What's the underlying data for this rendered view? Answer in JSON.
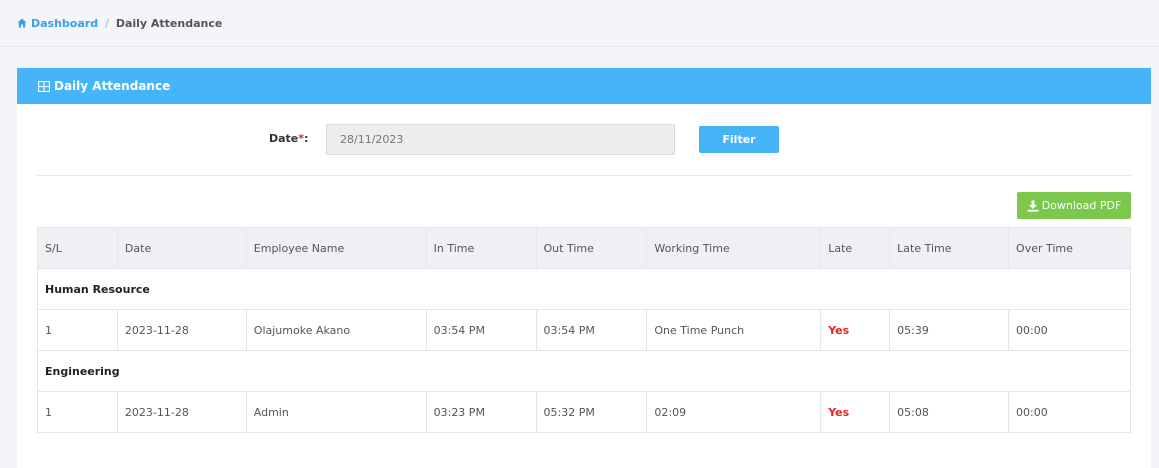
{
  "breadcrumb": {
    "home_label": "Dashboard",
    "separator": "/",
    "current": "Daily Attendance"
  },
  "card": {
    "title": "Daily Attendance"
  },
  "filter": {
    "date_label": "Date",
    "required_mark": "*",
    "date_suffix": ":",
    "date_value": "28/11/2023",
    "button_label": "Filter"
  },
  "download": {
    "label": "Download PDF"
  },
  "table": {
    "columns": [
      "S/L",
      "Date",
      "Employee Name",
      "In Time",
      "Out Time",
      "Working Time",
      "Late",
      "Late Time",
      "Over Time"
    ],
    "groups": [
      {
        "name": "Human Resource",
        "rows": [
          {
            "sl": "1",
            "date": "2023-11-28",
            "employee": "Olajumoke Akano",
            "in_time": "03:54 PM",
            "out_time": "03:54 PM",
            "working_time": "One Time Punch",
            "late": "Yes",
            "late_time": "05:39",
            "over_time": "00:00"
          }
        ]
      },
      {
        "name": "Engineering",
        "rows": [
          {
            "sl": "1",
            "date": "2023-11-28",
            "employee": "Admin",
            "in_time": "03:23 PM",
            "out_time": "05:32 PM",
            "working_time": "02:09",
            "late": "Yes",
            "late_time": "05:08",
            "over_time": "00:00"
          }
        ]
      }
    ]
  },
  "colors": {
    "primary": "#45b4f8",
    "success": "#7cc84d",
    "danger": "#e02424"
  },
  "icons": {
    "home": "home-icon",
    "table": "table-icon",
    "download": "download-icon"
  }
}
